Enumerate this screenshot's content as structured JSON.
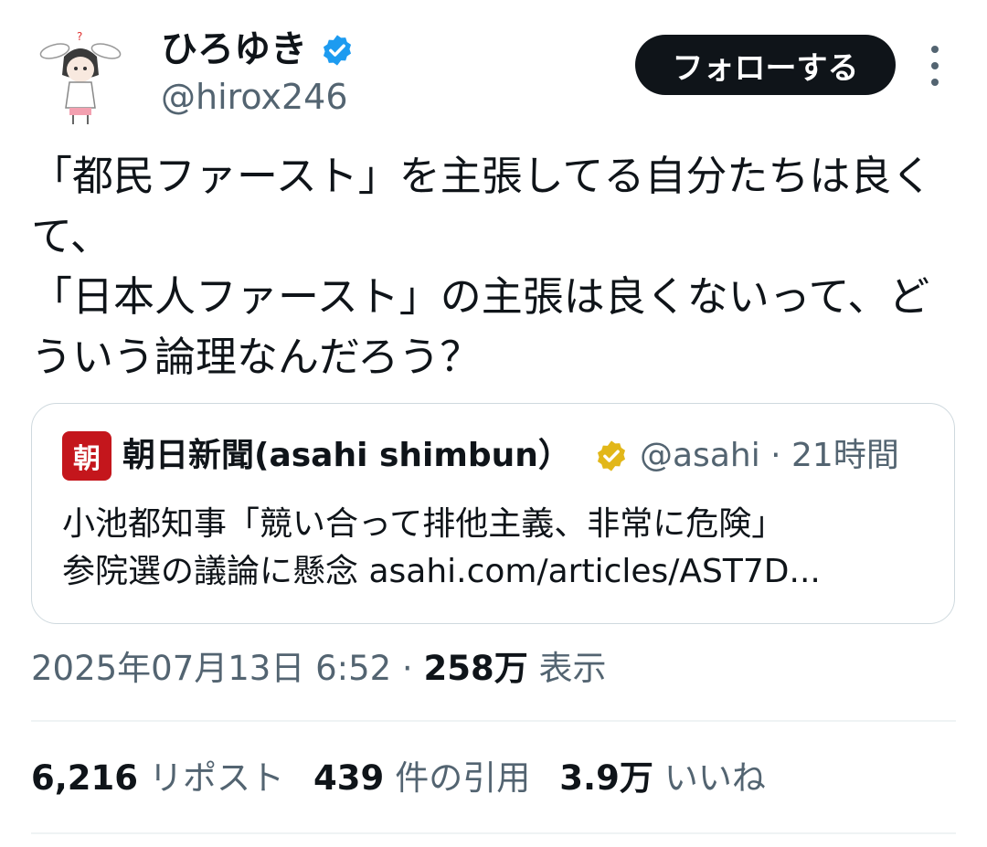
{
  "author": {
    "display_name": "ひろゆき",
    "handle": "@hirox246",
    "verified_color": "#1d9bf0",
    "avatar_icon": "bunny-ear-character-avatar"
  },
  "actions": {
    "follow_label": "フォローする",
    "more_icon": "more-vertical-icon"
  },
  "tweet": {
    "text": "「都民ファースト」を主張してる自分たちは良くて、\n「日本人ファースト」の主張は良くないって、どういう論理なんだろう？"
  },
  "quote": {
    "avatar_glyph": "朝",
    "avatar_color": "#c4161c",
    "name": "朝日新聞(asahi shimbun）",
    "verified_color": "#e2b719",
    "meta": "@asahi · 21時間",
    "line1": "小池都知事「競い合って排他主義、非常に危険」",
    "line2": "参院選の議論に懸念 asahi.com/articles/AST7D..."
  },
  "meta": {
    "timestamp": "2025年07月13日 6:52 · ",
    "views_count": "258万",
    "views_label": " 表示"
  },
  "stats": [
    {
      "num": "6,216",
      "label": "リポスト"
    },
    {
      "num": "439",
      "label": "件の引用"
    },
    {
      "num": "3.9万",
      "label": "いいね"
    }
  ]
}
